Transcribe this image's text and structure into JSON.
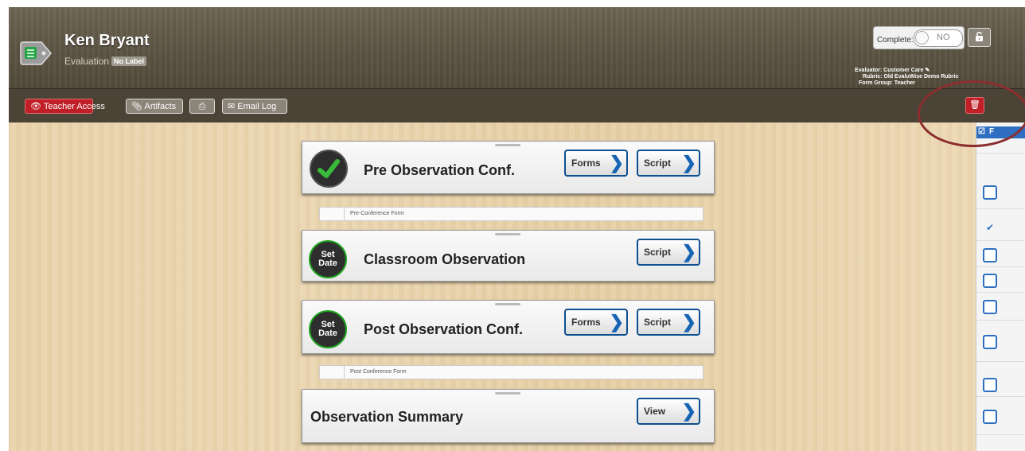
{
  "header": {
    "name": "Ken Bryant",
    "subtitle": "Evaluation",
    "label_badge": "No Label",
    "complete_label": "Complete:",
    "complete_toggle": "NO",
    "evaluator": "Evaluator: Customer Care",
    "rubric": "Rubric: Old EvaluWise Demo Rubric",
    "form_group": "Form Group: Teacher"
  },
  "toolbar": {
    "teacher_access": "Teacher Access",
    "artifacts": "Artifacts",
    "email_log": "Email Log"
  },
  "steps": [
    {
      "title": "Pre Observation Conf.",
      "status": "complete",
      "forms": "Forms",
      "script": "Script",
      "subform": "Pre-Conference Form"
    },
    {
      "title": "Classroom Observation",
      "status": "Set Date",
      "script": "Script"
    },
    {
      "title": "Post Observation Conf.",
      "status": "Set Date",
      "forms": "Forms",
      "script": "Script",
      "subform": "Post Conference Form"
    },
    {
      "title": "Observation Summary",
      "view": "View"
    }
  ],
  "sidebar": {
    "header_glyph": "F"
  },
  "colors": {
    "accent_blue": "#2e6fc1",
    "danger_red": "#c01f27",
    "annotation": "#8b2e2e"
  }
}
